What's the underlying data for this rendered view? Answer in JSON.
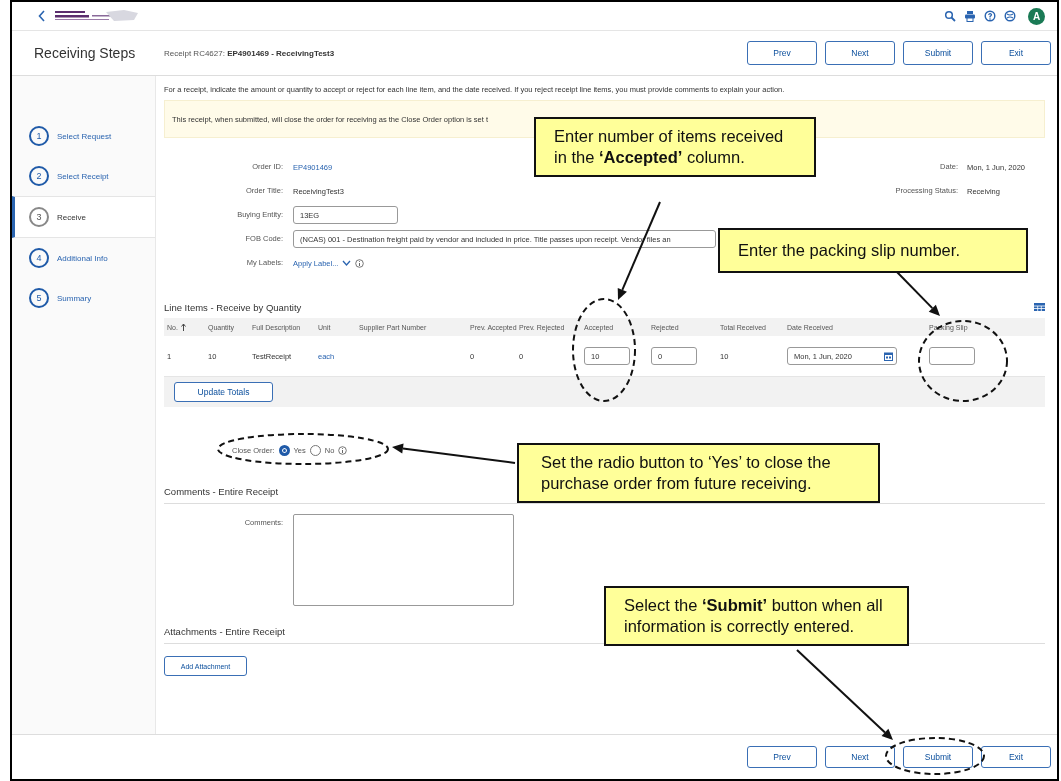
{
  "top_bar": {
    "avatar": "A"
  },
  "header": {
    "title": "Receiving Steps",
    "receipt": "Receipt RC4627: **EP4901469 - ReceivingTest3**",
    "buttons": [
      "Prev",
      "Next",
      "Submit",
      "Exit"
    ]
  },
  "steps": [
    {
      "number": "1",
      "label": "Select Request",
      "selected": false
    },
    {
      "number": "2",
      "label": "Select Receipt",
      "selected": false
    },
    {
      "number": "3",
      "label": "Receive",
      "selected": true
    },
    {
      "number": "4",
      "label": "Additional Info",
      "selected": false
    },
    {
      "number": "5",
      "label": "Summary",
      "selected": false
    }
  ],
  "instructions": "For a receipt, indicate the amount or quantity to accept or reject for each line item, and the date received. If you reject receipt line items, you must provide comments to explain your action.",
  "notice": "This receipt, when submitted, will close the order for receiving as the Close Order option is set t",
  "order_details": [
    {
      "label": "Order ID:",
      "kind": "link",
      "value": "EP4901469"
    },
    {
      "label": "Order Title:",
      "kind": "text",
      "value": "ReceivingTest3"
    },
    {
      "label": "Buying Entity:",
      "kind": "input",
      "value": "13EG"
    },
    {
      "label": "FOB Code:",
      "kind": "wide_input",
      "value": "(NCAS) 001 - Destination freight paid by vendor and included in price. Title passes upon receipt. Vendor files an"
    },
    {
      "label": "My Labels:",
      "kind": "dropdown_link",
      "value": "Apply Label..."
    }
  ],
  "order_status": [
    {
      "label": "Date:",
      "value": "Mon, 1 Jun, 2020"
    },
    {
      "label": "Processing Status:",
      "value": "Receiving"
    }
  ],
  "line_items": {
    "title": "Line Items - Receive by Quantity",
    "columns": [
      {
        "label": "No.",
        "sorted": true
      },
      {
        "label": "Quantity",
        "sorted": false
      },
      {
        "label": "Full Description",
        "sorted": false
      },
      {
        "label": "Unit",
        "sorted": false
      },
      {
        "label": "Supplier Part Number",
        "sorted": false
      },
      {
        "label": "Prev. Accepted",
        "sorted": false
      },
      {
        "label": "Prev. Rejected",
        "sorted": false
      },
      {
        "label": "Accepted",
        "sorted": false
      },
      {
        "label": "Rejected",
        "sorted": false
      },
      {
        "label": "Total Received",
        "sorted": false
      },
      {
        "label": "Date Received",
        "sorted": false
      },
      {
        "label": "Packing Slip",
        "sorted": false
      }
    ],
    "rows": [
      {
        "cells": [
          {
            "kind": "text",
            "value": "1"
          },
          {
            "kind": "text",
            "value": "10"
          },
          {
            "kind": "text",
            "value": "TestReceipt"
          },
          {
            "kind": "link",
            "value": "each"
          },
          {
            "kind": "blank"
          },
          {
            "kind": "text",
            "value": "0"
          },
          {
            "kind": "text",
            "value": "0"
          },
          {
            "kind": "input",
            "value": "10"
          },
          {
            "kind": "input",
            "value": "0"
          },
          {
            "kind": "text",
            "value": "10"
          },
          {
            "kind": "date",
            "value": "Mon, 1 Jun, 2020"
          },
          {
            "kind": "input"
          }
        ]
      }
    ],
    "update_button": "Update Totals"
  },
  "close_order": {
    "label": "Close Order:",
    "options": [
      {
        "label": "Yes",
        "selected": true
      },
      {
        "label": "No",
        "selected": false
      }
    ]
  },
  "comments": {
    "title": "Comments - Entire Receipt",
    "label": "Comments:"
  },
  "attachments": {
    "title": "Attachments - Entire Receipt",
    "button": "Add Attachment"
  },
  "footer_buttons": [
    "Prev",
    "Next",
    "Submit",
    "Exit"
  ],
  "callouts": [
    {
      "text": "Enter number of items received in the **‘Accepted’** column."
    },
    {
      "text": "Enter the packing slip number."
    },
    {
      "text": "Set the radio button to ‘Yes’ to close the purchase order from future receiving."
    },
    {
      "text": "Select the **‘Submit’** button when all information is correctly entered."
    }
  ]
}
